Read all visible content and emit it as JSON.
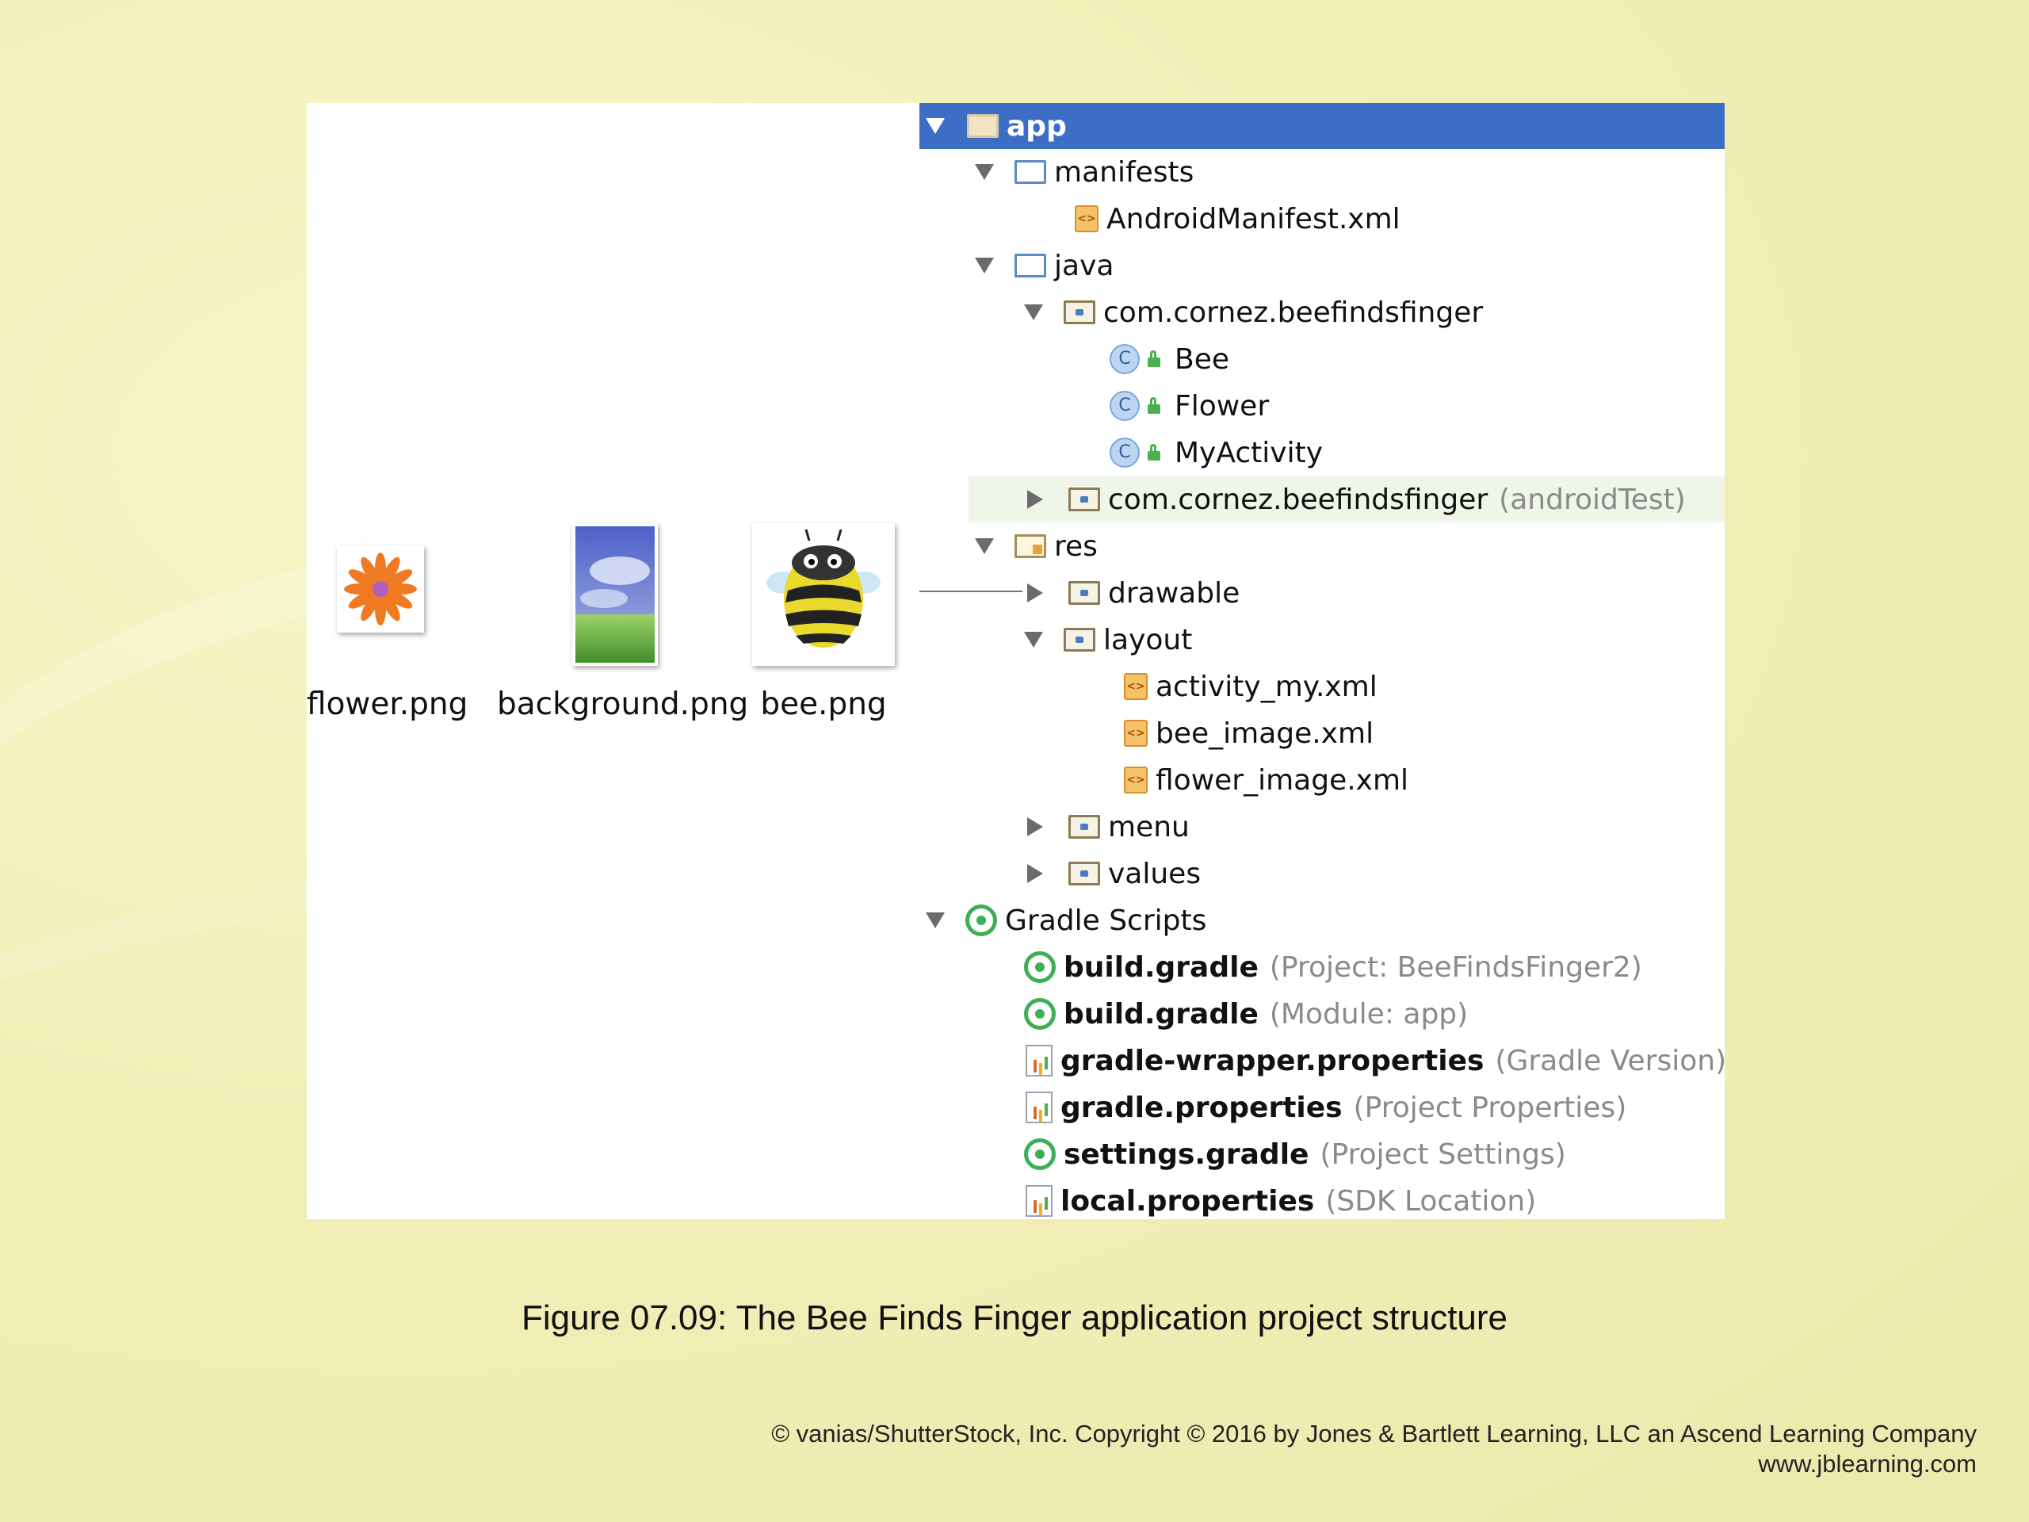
{
  "thumbnails": [
    {
      "file": "flower.png",
      "icon": "flower-icon"
    },
    {
      "file": "background.png",
      "icon": "background-image-icon"
    },
    {
      "file": "bee.png",
      "icon": "bee-icon"
    }
  ],
  "tree": {
    "app": "app",
    "manifests": "manifests",
    "android_manifest": "AndroidManifest.xml",
    "java": "java",
    "package_main": "com.cornez.beefindsfinger",
    "class_bee": "Bee",
    "class_flower": "Flower",
    "class_myactivity": "MyActivity",
    "package_test": "com.cornez.beefindsfinger",
    "package_test_suffix": "(androidTest)",
    "res": "res",
    "drawable": "drawable",
    "layout": "layout",
    "activity_my": "activity_my.xml",
    "bee_image": "bee_image.xml",
    "flower_image": "flower_image.xml",
    "menu": "menu",
    "values": "values",
    "gradle_scripts": "Gradle Scripts",
    "build_gradle_project": "build.gradle",
    "build_gradle_project_suffix": "(Project: BeeFindsFinger2)",
    "build_gradle_module": "build.gradle",
    "build_gradle_module_suffix": "(Module: app)",
    "gradle_wrapper": "gradle-wrapper.properties",
    "gradle_wrapper_suffix": "(Gradle Version)",
    "gradle_properties": "gradle.properties",
    "gradle_properties_suffix": "(Project Properties)",
    "settings_gradle": "settings.gradle",
    "settings_gradle_suffix": "(Project Settings)",
    "local_properties": "local.properties",
    "local_properties_suffix": "(SDK Location)"
  },
  "colors": {
    "selection": "#3d6ec6",
    "background": "#f1efb8"
  },
  "caption": "Figure 07.09: The Bee Finds Finger application project structure",
  "credit": {
    "line1": "© vanias/ShutterStock, Inc. Copyright © 2016 by Jones & Bartlett Learning, LLC an Ascend Learning Company",
    "line2": "www.jblearning.com"
  }
}
